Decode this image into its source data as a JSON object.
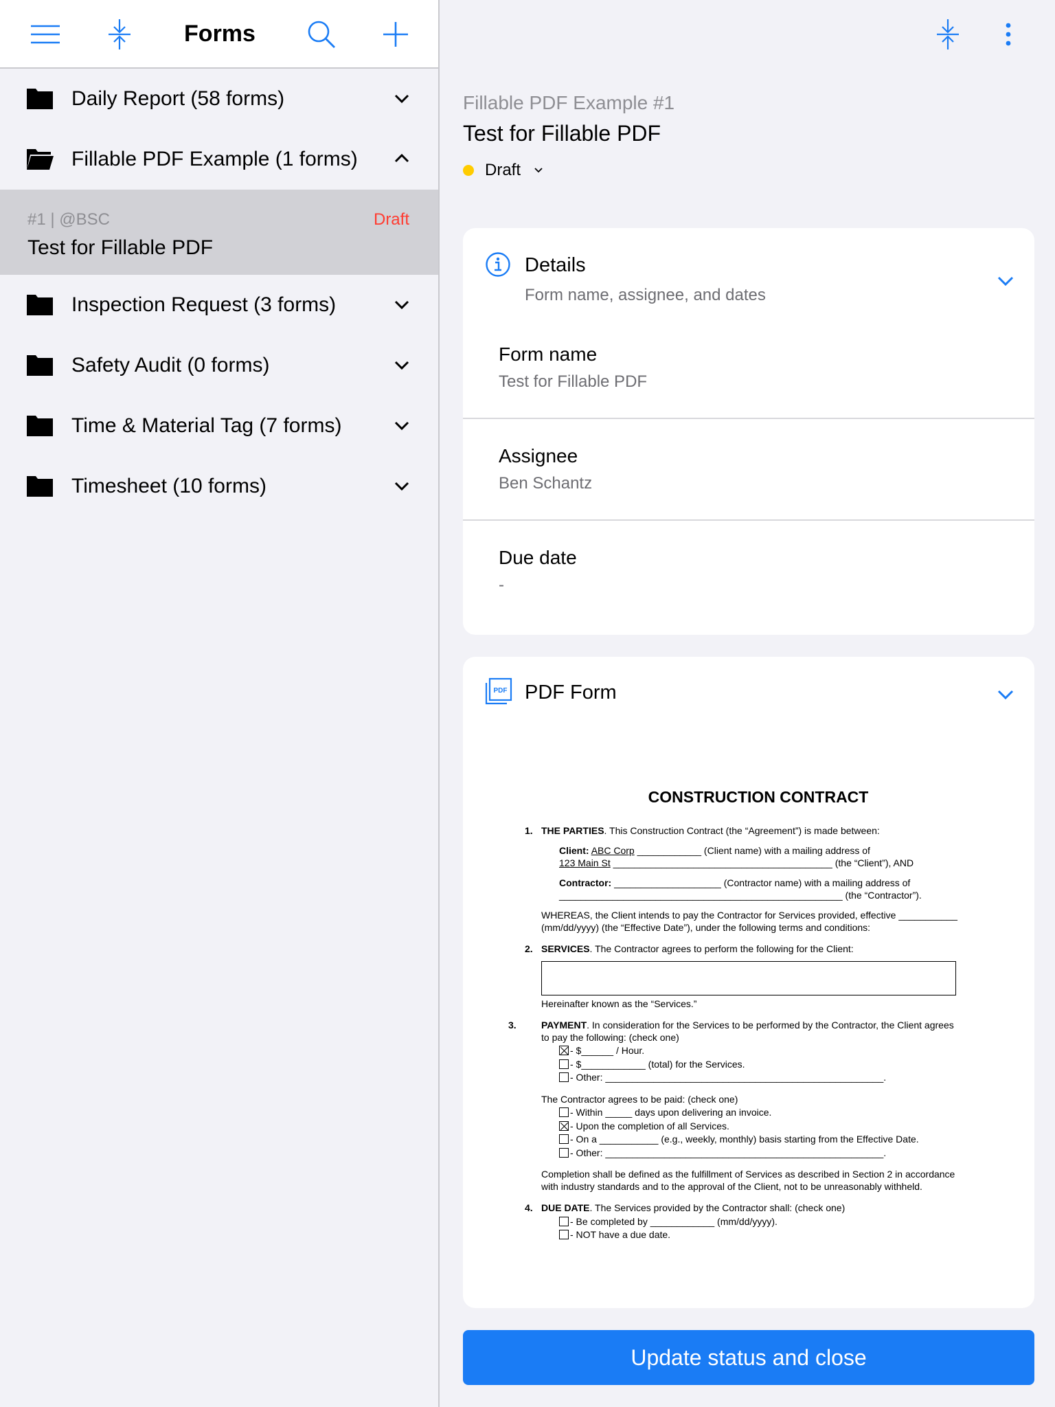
{
  "left": {
    "title": "Forms",
    "folders_top": [
      {
        "label": "Daily Report (58 forms)",
        "expanded": false
      },
      {
        "label": "Fillable PDF Example (1 forms)",
        "expanded": true
      }
    ],
    "selected_item": {
      "meta": "#1 | @BSC",
      "status": "Draft",
      "title": "Test for Fillable PDF"
    },
    "folders_bottom": [
      {
        "label": "Inspection Request (3 forms)"
      },
      {
        "label": "Safety Audit (0 forms)"
      },
      {
        "label": "Time & Material Tag (7 forms)"
      },
      {
        "label": "Timesheet (10 forms)"
      }
    ]
  },
  "right": {
    "subtitle": "Fillable PDF Example #1",
    "title": "Test for Fillable PDF",
    "status": "Draft",
    "status_color": "#ffcc00",
    "details": {
      "header": "Details",
      "subheader": "Form name, assignee, and dates",
      "fields": [
        {
          "label": "Form name",
          "value": "Test for Fillable PDF"
        },
        {
          "label": "Assignee",
          "value": "Ben Schantz"
        },
        {
          "label": "Due date",
          "value": "-"
        }
      ]
    },
    "pdf_card": {
      "header": "PDF Form",
      "icon_text": "PDF",
      "doc": {
        "title": "CONSTRUCTION CONTRACT",
        "s1_num": "1.",
        "s1_head": "THE PARTIES",
        "s1_text": ". This Construction Contract (the “Agreement”) is made between:",
        "client_label": "Client:",
        "client_line1": "ABC Corp",
        "client_line1_rest": " ____________ (Client name) with a mailing address of",
        "client_line2": "123 Main St",
        "client_line2_rest": " _________________________________________ (the “Client”), AND",
        "contractor_label": "Contractor:",
        "contractor_line1": " ____________________ (Contractor name) with a mailing address of",
        "contractor_line2": "_____________________________________________________ (the “Contractor”).",
        "whereas": "WHEREAS, the Client intends to pay the Contractor for Services provided, effective ___________ (mm/dd/yyyy) (the “Effective Date”), under the following terms and conditions:",
        "s2_num": "2.",
        "s2_head": "SERVICES",
        "s2_text": ". The Contractor agrees to perform the following for the Client:",
        "s2_after": "Hereinafter known as the “Services.”",
        "s3_num": "3.",
        "s3_head": "PAYMENT",
        "s3_text": ". In consideration for the Services to be performed by the Contractor, the Client agrees to pay the following: (check one)",
        "pay_opts": [
          "- $______ / Hour.",
          "- $____________ (total) for the Services.",
          "- Other: ____________________________________________________."
        ],
        "paid_intro": "The Contractor agrees to be paid: (check one)",
        "paid_opts": [
          "- Within _____ days upon delivering an invoice.",
          "- Upon the completion of all Services.",
          "- On a ___________ (e.g., weekly, monthly) basis starting from the Effective Date.",
          "- Other: ____________________________________________________."
        ],
        "completion": "Completion shall be defined as the fulfillment of Services as described in Section 2 in accordance with industry standards and to the approval of the Client, not to be unreasonably withheld.",
        "s4_num": "4.",
        "s4_head": "DUE DATE",
        "s4_text": ". The Services provided by the Contractor shall: (check one)",
        "due_opts": [
          "- Be completed by ____________ (mm/dd/yyyy).",
          "- NOT have a due date."
        ]
      }
    },
    "cta": "Update status and close"
  },
  "colors": {
    "accent": "#1a7cf5",
    "draft_red": "#ff3b30",
    "selected_bg": "#d1d1d6"
  },
  "icons": [
    "menu-icon",
    "collapse-icon",
    "search-icon",
    "plus-icon",
    "folder-icon",
    "folder-open-icon",
    "chevron-down-icon",
    "chevron-up-icon",
    "more-vertical-icon",
    "info-icon",
    "pdf-icon"
  ]
}
